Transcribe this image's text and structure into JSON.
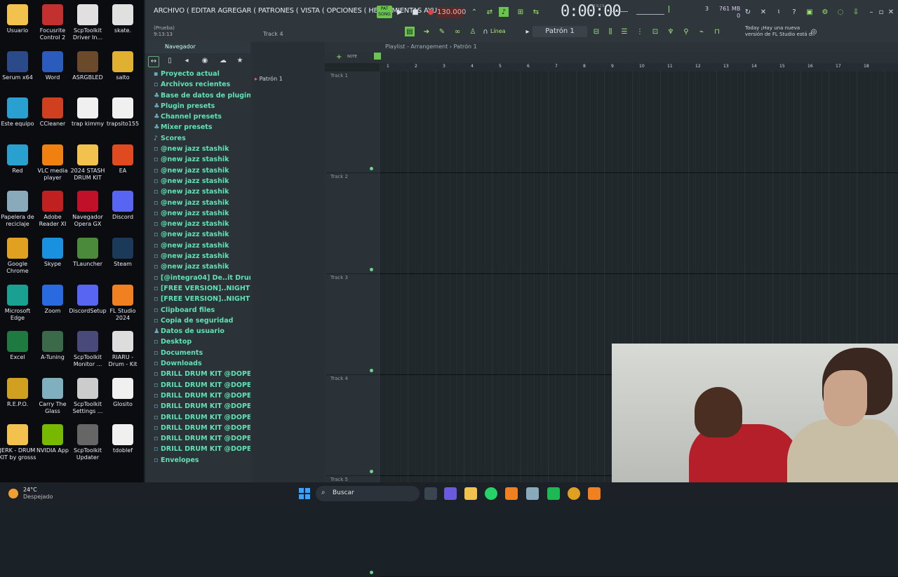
{
  "desktop": {
    "icons": [
      {
        "label": "Usuario",
        "color": "#f2c14e"
      },
      {
        "label": "Focusrite Control 2",
        "color": "#c23030"
      },
      {
        "label": "ScpToolkit Driver In...",
        "color": "#e0e0e0"
      },
      {
        "label": "skate.",
        "color": "#e0e0e0"
      },
      {
        "label": "Serum x64",
        "color": "#2a4a8a"
      },
      {
        "label": "Word",
        "color": "#2b5bbd"
      },
      {
        "label": "ASRGBLED",
        "color": "#6a4a2a"
      },
      {
        "label": "salto",
        "color": "#e0b030"
      },
      {
        "label": "Este equipo",
        "color": "#2aa0d0"
      },
      {
        "label": "CCleaner",
        "color": "#d04020"
      },
      {
        "label": "trap kimmy",
        "color": "#f0f0f0"
      },
      {
        "label": "trapsito155",
        "color": "#f0f0f0"
      },
      {
        "label": "Red",
        "color": "#2aa0d0"
      },
      {
        "label": "VLC media player",
        "color": "#f08010"
      },
      {
        "label": "2024 STASH DRUM KIT",
        "color": "#f2c14e"
      },
      {
        "label": "EA",
        "color": "#e04a20"
      },
      {
        "label": "Papelera de reciclaje",
        "color": "#8ab"
      },
      {
        "label": "Adobe Reader XI",
        "color": "#c02020"
      },
      {
        "label": "Navegador Opera GX",
        "color": "#c0102a"
      },
      {
        "label": "Discord",
        "color": "#5865f2"
      },
      {
        "label": "Google Chrome",
        "color": "#e0a020"
      },
      {
        "label": "Skype",
        "color": "#1a90e0"
      },
      {
        "label": "TLauncher",
        "color": "#4a8a3a"
      },
      {
        "label": "Steam",
        "color": "#1b3a5a"
      },
      {
        "label": "Microsoft Edge",
        "color": "#1aa090"
      },
      {
        "label": "Zoom",
        "color": "#2a6ae0"
      },
      {
        "label": "DiscordSetup",
        "color": "#5865f2"
      },
      {
        "label": "FL Studio 2024",
        "color": "#f08020"
      },
      {
        "label": "Excel",
        "color": "#1e7a40"
      },
      {
        "label": "A-Tuning",
        "color": "#3a6a4a"
      },
      {
        "label": "ScpToolkit Monitor ...",
        "color": "#4a4a7a"
      },
      {
        "label": "RIARU - Drum - Kit",
        "color": "#dddddd"
      },
      {
        "label": "R.E.P.O.",
        "color": "#d0a020"
      },
      {
        "label": "Carry The Glass",
        "color": "#80b0c0"
      },
      {
        "label": "ScpToolkit Settings ...",
        "color": "#cccccc"
      },
      {
        "label": "Glosito",
        "color": "#f0f0f0"
      },
      {
        "label": "JERK - DRUM KIT by grosss",
        "color": "#f2c14e"
      },
      {
        "label": "NVIDIA App",
        "color": "#76b900"
      },
      {
        "label": "ScpToolkit Updater",
        "color": "#666666"
      },
      {
        "label": "tdoblef",
        "color": "#f0f0f0"
      }
    ]
  },
  "fl": {
    "menu": "ARCHIVO ( EDITAR AGREGAR ( PATRONES ( VISTA ( OPCIONES ( HERRAMIENTAS AYUD",
    "song_name": "(Prueba)",
    "song_time": "9:13:13",
    "track_hint": "Track 4",
    "pat_badge_top": "PAT",
    "pat_badge_bottom": "SONG",
    "tempo": "130.000",
    "time": "0:00:00",
    "time_label": "M:S:CS",
    "mem_top": "761 MB",
    "mem_bottom": "0",
    "news_line1": "Today  ¡Hay una nueva",
    "news_line2": "versión de FL Studio está d..",
    "linea": "Línea",
    "pattern": "Patrón 1",
    "browser_title": "Navegador",
    "browser_items": [
      {
        "label": "Proyecto actual",
        "icon": "▪"
      },
      {
        "label": "Archivos recientes",
        "icon": "▫"
      },
      {
        "label": "Base de datos de plugins",
        "icon": "♣"
      },
      {
        "label": "Plugin presets",
        "icon": "♣"
      },
      {
        "label": "Channel presets",
        "icon": "♣"
      },
      {
        "label": "Mixer presets",
        "icon": "♣"
      },
      {
        "label": "Scores",
        "icon": "♪"
      },
      {
        "label": "@new jazz stashik",
        "icon": "▫"
      },
      {
        "label": "@new jazz stashik",
        "icon": "▫"
      },
      {
        "label": "@new jazz stashik",
        "icon": "▫"
      },
      {
        "label": "@new jazz stashik",
        "icon": "▫"
      },
      {
        "label": "@new jazz stashik",
        "icon": "▫"
      },
      {
        "label": "@new jazz stashik",
        "icon": "▫"
      },
      {
        "label": "@new jazz stashik",
        "icon": "▫"
      },
      {
        "label": "@new jazz stashik",
        "icon": "▫"
      },
      {
        "label": "@new jazz stashik",
        "icon": "▫"
      },
      {
        "label": "@new jazz stashik",
        "icon": "▫"
      },
      {
        "label": "@new jazz stashik",
        "icon": "▫"
      },
      {
        "label": "@new jazz stashik",
        "icon": "▫"
      },
      {
        "label": "[@integra04] De..it Drumkit 2023",
        "icon": "▫"
      },
      {
        "label": "[FREE VERSION]..NIGHT VISION'",
        "icon": "▫"
      },
      {
        "label": "[FREE VERSION]..NIGHT VISION'",
        "icon": "▫"
      },
      {
        "label": "Clipboard files",
        "icon": "▫"
      },
      {
        "label": "Copia de seguridad",
        "icon": "▫"
      },
      {
        "label": "Datos de usuario",
        "icon": "♟"
      },
      {
        "label": "Desktop",
        "icon": "▫"
      },
      {
        "label": "Documents",
        "icon": "▫"
      },
      {
        "label": "Downloads",
        "icon": "▫"
      },
      {
        "label": "DRILL DRUM KIT @DOPEKIT",
        "icon": "▫"
      },
      {
        "label": "DRILL DRUM KIT @DOPEKIT",
        "icon": "▫"
      },
      {
        "label": "DRILL DRUM KIT @DOPEKIT",
        "icon": "▫"
      },
      {
        "label": "DRILL DRUM KIT @DOPEKIT",
        "icon": "▫"
      },
      {
        "label": "DRILL DRUM KIT @DOPEKIT",
        "icon": "▫"
      },
      {
        "label": "DRILL DRUM KIT @DOPEKIT",
        "icon": "▫"
      },
      {
        "label": "DRILL DRUM KIT @DOPEKIT",
        "icon": "▫"
      },
      {
        "label": "DRILL DRUM KIT @DOPEKIT",
        "icon": "▫"
      },
      {
        "label": "Envelopes",
        "icon": "▫"
      }
    ],
    "channel_item": "Patrón 1",
    "playlist_title": "Playlist - Arrangement › Patrón 1",
    "ruler": [
      "1",
      "2",
      "3",
      "4",
      "5",
      "6",
      "7",
      "8",
      "9",
      "10",
      "11",
      "12",
      "13",
      "14",
      "15",
      "16",
      "17",
      "18"
    ],
    "tracks": [
      "Track 1",
      "Track 2",
      "Track 3",
      "Track 4",
      "Track 5"
    ]
  },
  "taskbar": {
    "temp": "24°C",
    "weather": "Despejado",
    "search": "Buscar"
  }
}
